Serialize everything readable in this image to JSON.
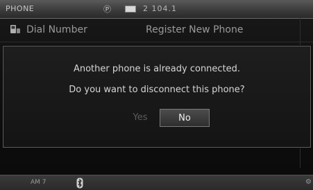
{
  "status_bar": {
    "title": "PHONE",
    "signal_label": "Ⓟ",
    "radio": "2  104.1"
  },
  "menu": {
    "dial_number": "Dial Number",
    "register_new_phone": "Register New Phone"
  },
  "dialog": {
    "line1": "Another phone is already connected.",
    "line2": "Do you want to disconnect this phone?",
    "yes_label": "Yes",
    "no_label": "No"
  },
  "bottom_bar": {
    "text": "AM 7"
  },
  "colors": {
    "accent": "#f0f0f0",
    "dim": "#5c5c5c"
  },
  "icons": {
    "phone": "phone-icon",
    "bluetooth": "bluetooth-icon",
    "battery": "battery-icon",
    "settings": "gear-icon"
  }
}
